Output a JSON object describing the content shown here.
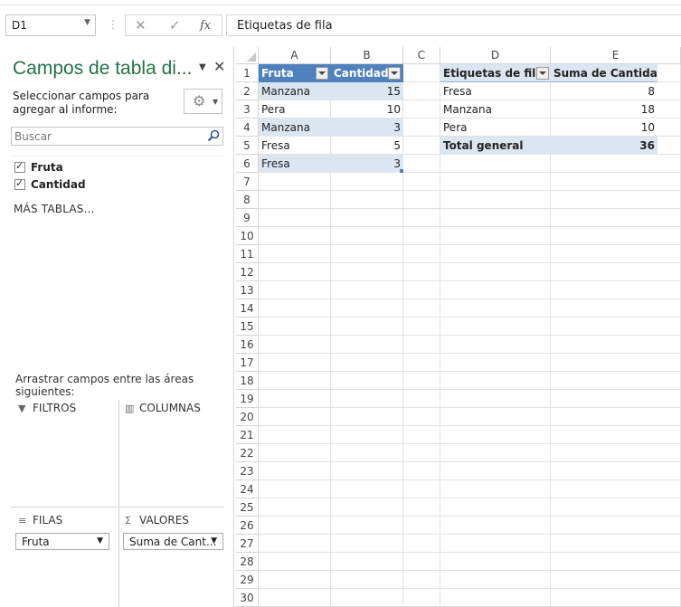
{
  "formula_bar": {
    "name_box": "D1",
    "cancel_icon": "x-icon",
    "enter_icon": "check-icon",
    "fx_label": "fx",
    "content": "Etiquetas de fila"
  },
  "pane": {
    "title": "Campos de tabla di...",
    "select_text": "Seleccionar campos para agregar al informe:",
    "search_placeholder": "Buscar",
    "fields": [
      {
        "label": "Fruta",
        "checked": true
      },
      {
        "label": "Cantidad",
        "checked": true
      }
    ],
    "more_tables": "MÁS TABLAS...",
    "drag_text": "Arrastrar campos entre las áreas siguientes:",
    "areas": {
      "filters": "FILTROS",
      "columns": "COLUMNAS",
      "rows": "FILAS",
      "values": "VALORES"
    },
    "rows_item": "Fruta",
    "values_item": "Suma de Cant..."
  },
  "sheet": {
    "columns": [
      "A",
      "B",
      "C",
      "D",
      "E"
    ],
    "rows": [
      "1",
      "2",
      "3",
      "4",
      "5",
      "6",
      "7",
      "8",
      "9",
      "10",
      "11",
      "12",
      "13",
      "14",
      "15",
      "16",
      "17",
      "18",
      "19",
      "20",
      "21",
      "22",
      "23",
      "24",
      "25",
      "26",
      "27",
      "28",
      "29",
      "30"
    ],
    "table": {
      "headers": [
        "Fruta",
        "Cantidad"
      ],
      "data": [
        [
          "Manzana",
          "15"
        ],
        [
          "Pera",
          "10"
        ],
        [
          "Manzana",
          "3"
        ],
        [
          "Fresa",
          "5"
        ],
        [
          "Fresa",
          "3"
        ]
      ]
    },
    "pivot": {
      "headers": [
        "Etiquetas de fila",
        "Suma de Cantidad"
      ],
      "data": [
        [
          "Fresa",
          "8"
        ],
        [
          "Manzana",
          "18"
        ],
        [
          "Pera",
          "10"
        ]
      ],
      "total": [
        "Total general",
        "36"
      ]
    }
  }
}
